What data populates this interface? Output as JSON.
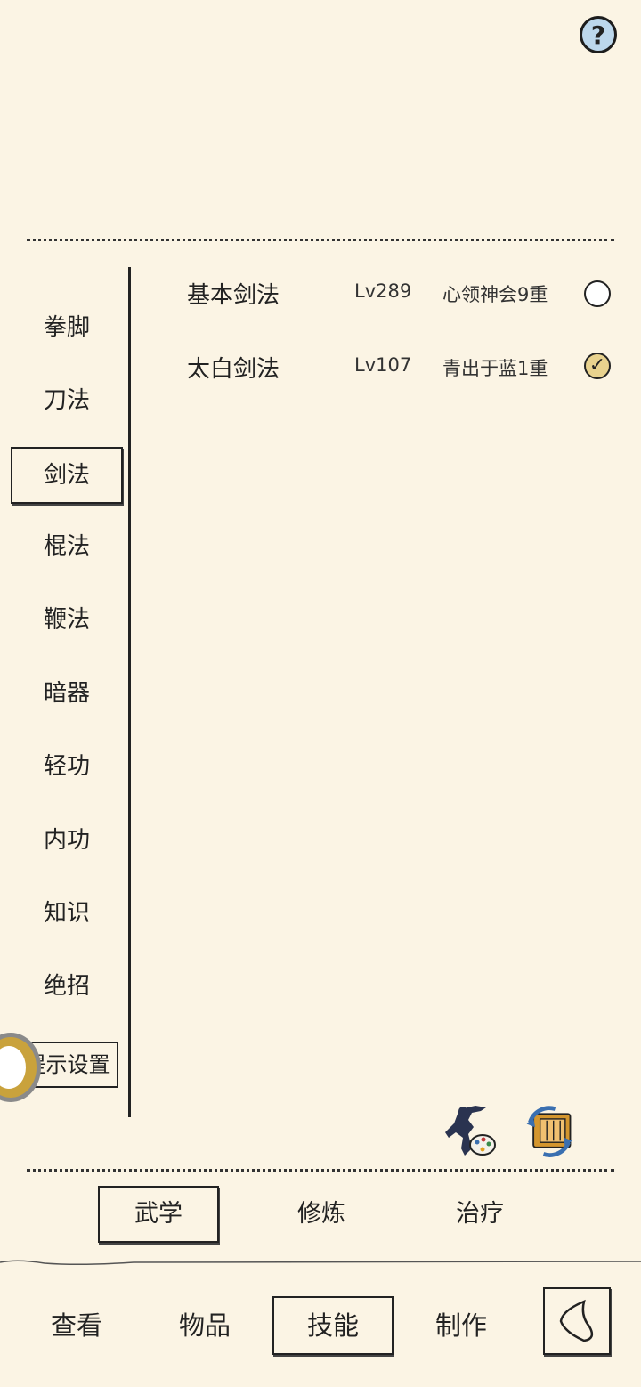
{
  "header": {
    "help_label": "?"
  },
  "categories": [
    {
      "label": "拳脚"
    },
    {
      "label": "刀法"
    },
    {
      "label": "剑法"
    },
    {
      "label": "棍法"
    },
    {
      "label": "鞭法"
    },
    {
      "label": "暗器"
    },
    {
      "label": "轻功"
    },
    {
      "label": "内功"
    },
    {
      "label": "知识"
    },
    {
      "label": "绝招"
    }
  ],
  "selected_category": "剑法",
  "hint_button": {
    "label": "提示设置"
  },
  "skills": [
    {
      "name": "基本剑法",
      "level": "Lv289",
      "stage": "心领神会9重",
      "checked": false
    },
    {
      "name": "太白剑法",
      "level": "Lv107",
      "stage": "青出于蓝1重",
      "checked": true
    }
  ],
  "subtabs": [
    {
      "label": "武学",
      "selected": true
    },
    {
      "label": "修炼",
      "selected": false
    },
    {
      "label": "治疗",
      "selected": false
    }
  ],
  "bottom_tabs": [
    {
      "label": "查看",
      "selected": false
    },
    {
      "label": "物品",
      "selected": false
    },
    {
      "label": "技能",
      "selected": true
    },
    {
      "label": "制作",
      "selected": false
    }
  ],
  "colors": {
    "background": "#fbf4e4",
    "ink": "#222222",
    "help_blue": "#bcd7ec",
    "check_gold": "#e8d28e"
  }
}
